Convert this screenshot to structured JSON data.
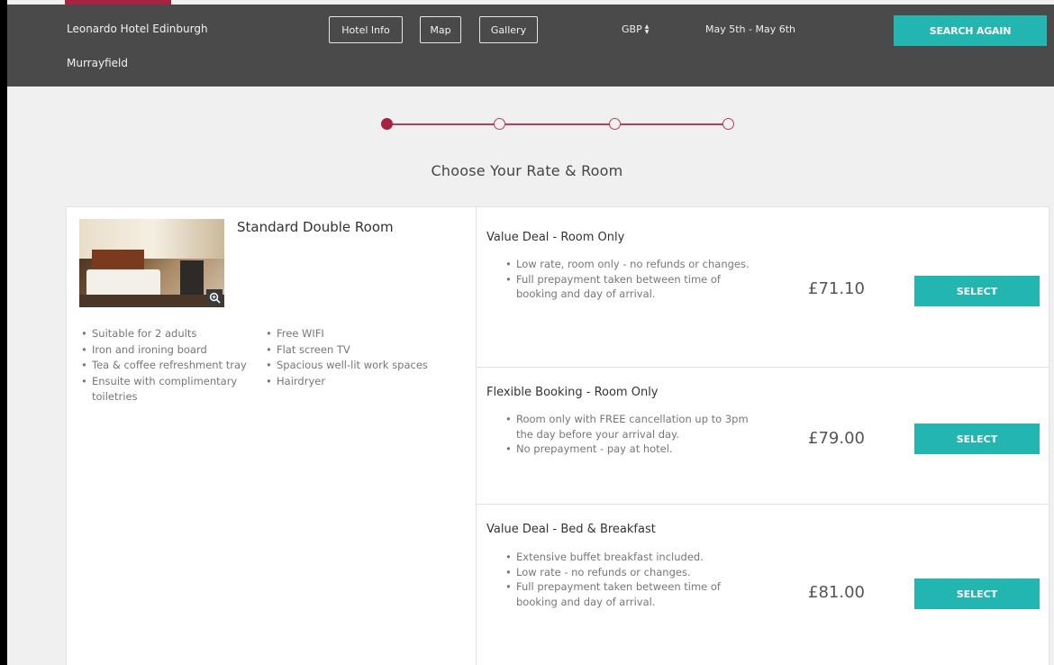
{
  "header": {
    "hotel_name_line1": "Leonardo Hotel Edinburgh",
    "hotel_name_line2": "Murrayfield",
    "nav": [
      "Hotel Info",
      "Map",
      "Gallery"
    ],
    "currency": "GBP",
    "dates": "May 5th - May 6th",
    "search_again": "SEARCH AGAIN"
  },
  "progress": {
    "current_step": 1,
    "total_steps": 4
  },
  "step_title": "Choose Your Rate & Room",
  "room": {
    "title": "Standard Double Room",
    "amenities_col1": [
      "Suitable for 2 adults",
      "Iron and ironing board",
      "Tea & coffee refreshment tray",
      "Ensuite with complimentary toiletries"
    ],
    "amenities_col2": [
      "Free WIFI",
      "Flat screen TV",
      "Spacious well-lit work spaces",
      "Hairdryer"
    ]
  },
  "rates": [
    {
      "title": "Value Deal - Room Only",
      "bullets": [
        "Low rate, room only - no refunds or changes.",
        "Full prepayment taken between time of booking and day of arrival."
      ],
      "price": "£71.10",
      "button": "SELECT"
    },
    {
      "title": "Flexible Booking - Room Only",
      "bullets": [
        "Room only with FREE cancellation up to 3pm the day before your arrival day.",
        "No prepayment - pay at hotel."
      ],
      "price": "£79.00",
      "button": "SELECT"
    },
    {
      "title": "Value Deal - Bed & Breakfast",
      "bullets": [
        "Extensive buffet breakfast included.",
        "Low rate - no refunds or changes.",
        "Full prepayment taken between time of booking and day of arrival."
      ],
      "price": "£81.00",
      "button": "SELECT"
    }
  ],
  "colors": {
    "header_bg": "#4a4a4a",
    "accent_teal": "#23b5b0",
    "accent_red": "#a6223f"
  },
  "icons": {
    "zoom": "zoom-icon",
    "currency_toggle": "up-down-chevron-icon"
  }
}
